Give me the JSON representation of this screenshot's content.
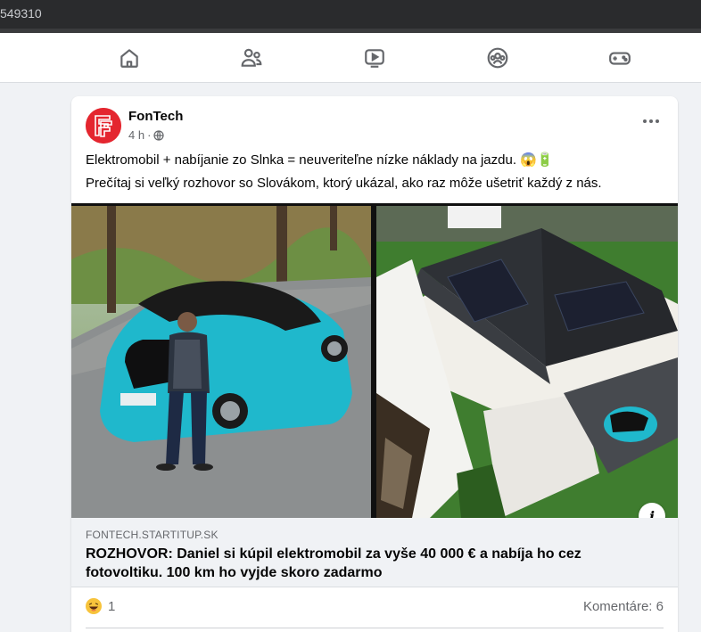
{
  "browser": {
    "url_fragment": "549310"
  },
  "nav": {
    "items": [
      {
        "name": "home-icon"
      },
      {
        "name": "friends-icon"
      },
      {
        "name": "watch-icon"
      },
      {
        "name": "groups-icon"
      },
      {
        "name": "gaming-icon"
      }
    ]
  },
  "post": {
    "page_name": "FonTech",
    "time": "4 h",
    "separator": "·",
    "text_line1": "Elektromobil + nabíjanie zo Slnka = neuveriteľne nízke náklady na jazdu. 😱🔋",
    "text_line2": "Prečítaj si veľký rozhovor so Slovákom, ktorý ukázal, ako raz môže ušetriť každý z nás.",
    "link": {
      "domain": "FONTECH.STARTITUP.SK",
      "title": "ROZHOVOR: Daniel si kúpil elektromobil za vyše 40 000 € a nabíja ho cez fotovoltiku. 100 km ho vyjde skoro zadarmo"
    },
    "info_label": "i",
    "reaction_count": "1",
    "comments_label": "Komentáre: 6"
  },
  "colors": {
    "accent": "#e4262f",
    "car": "#1fb8cc"
  }
}
